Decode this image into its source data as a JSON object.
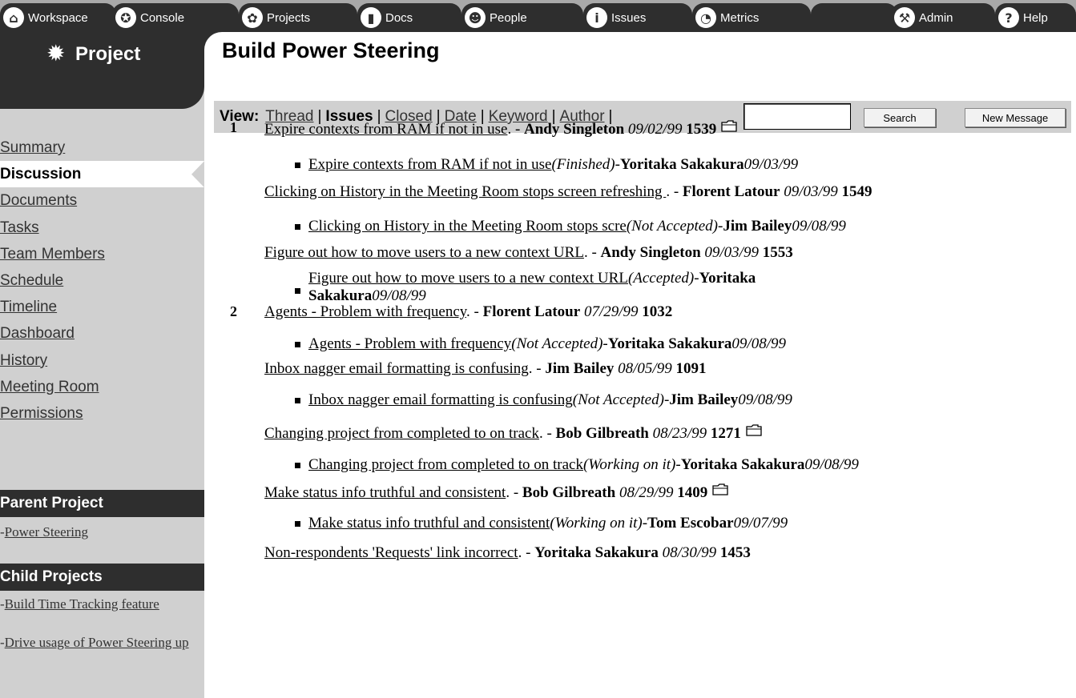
{
  "tabs": [
    {
      "label": "Workspace",
      "icon": "home-icon"
    },
    {
      "label": "Console",
      "icon": "console-icon"
    },
    {
      "label": "Projects",
      "icon": "projects-icon"
    },
    {
      "label": "Docs",
      "icon": "docs-icon"
    },
    {
      "label": "People",
      "icon": "people-icon"
    },
    {
      "label": "Issues",
      "icon": "info-icon"
    },
    {
      "label": "Metrics",
      "icon": "metrics-icon"
    },
    {
      "label": "",
      "icon": ""
    },
    {
      "label": "Admin",
      "icon": "admin-icon"
    },
    {
      "label": "Help",
      "icon": "help-icon"
    }
  ],
  "sidebar": {
    "title": "Project",
    "items": [
      {
        "label": "Summary"
      },
      {
        "label": "Discussion",
        "active": true
      },
      {
        "label": "Documents"
      },
      {
        "label": "Tasks"
      },
      {
        "label": "Team Members"
      },
      {
        "label": "Schedule"
      },
      {
        "label": "Timeline"
      },
      {
        "label": "Dashboard"
      },
      {
        "label": "History"
      },
      {
        "label": "Meeting Room"
      },
      {
        "label": "Permissions"
      }
    ],
    "parent_heading": "Parent Project",
    "parent_link": "Power Steering",
    "child_heading": "Child Projects",
    "child_links": [
      "Build Time Tracking feature",
      "Drive usage of Power Steering up"
    ]
  },
  "main": {
    "title": "Build Power Steering",
    "view_label": "View:",
    "views": [
      "Thread",
      "Issues",
      "Closed",
      "Date",
      "Keyword",
      "Author"
    ],
    "current_view": "Issues",
    "search_value": "",
    "search_button": "Search",
    "new_message_button": "New Message"
  },
  "threads": [
    {
      "group": "1",
      "title": "Expire contexts from RAM if not in use",
      "author": "Andy Singleton",
      "date": "09/02/99",
      "id": "1539",
      "attachment": true,
      "reply": {
        "title": "Expire contexts from RAM if not in use",
        "status": "(Finished)",
        "author": "Yoritaka Sakakura",
        "date": "09/03/99"
      }
    },
    {
      "group": "",
      "title": "Clicking on History in the Meeting Room stops screen refreshing ",
      "author": "Florent Latour",
      "date": "09/03/99",
      "id": "1549",
      "attachment": false,
      "reply": {
        "title": "Clicking on History in the Meeting Room stops scre",
        "status": "(Not Accepted)",
        "author": "Jim Bailey",
        "date": "09/08/99"
      }
    },
    {
      "group": "",
      "title": "Figure out how to move users to a new context URL",
      "author": "Andy Singleton",
      "date": "09/03/99",
      "id": "1553",
      "attachment": false,
      "reply": {
        "title": "Figure out how to move users to a new context URL",
        "status": "(Accepted)",
        "author": "Yoritaka Sakakura",
        "date": "09/08/99"
      }
    },
    {
      "group": "2",
      "title": "Agents - Problem with frequency",
      "author": "Florent Latour",
      "date": "07/29/99",
      "id": "1032",
      "attachment": false,
      "reply": {
        "title": "Agents - Problem with frequency",
        "status": "(Not Accepted)",
        "author": "Yoritaka Sakakura",
        "date": "09/08/99"
      }
    },
    {
      "group": "",
      "title": "Inbox nagger email formatting is confusing",
      "author": "Jim Bailey",
      "date": "08/05/99",
      "id": "1091",
      "attachment": false,
      "reply": {
        "title": "Inbox nagger email formatting is confusing",
        "status": "(Not Accepted)",
        "author": "Jim Bailey",
        "date": "09/08/99"
      }
    },
    {
      "group": "",
      "title": "Changing project from completed to on track",
      "author": "Bob Gilbreath",
      "date": "08/23/99",
      "id": "1271",
      "attachment": true,
      "reply": {
        "title": "Changing project from completed to on track",
        "status": "(Working on it)",
        "author": "Yoritaka Sakakura",
        "date": "09/08/99"
      }
    },
    {
      "group": "",
      "title": "Make status info truthful and consistent",
      "author": "Bob Gilbreath",
      "date": "08/29/99",
      "id": "1409",
      "attachment": true,
      "reply": {
        "title": "Make status info truthful and consistent",
        "status": "(Working on it)",
        "author": "Tom Escobar",
        "date": "09/07/99"
      }
    },
    {
      "group": "",
      "title": "Non-respondents 'Requests' link incorrect",
      "author": "Yoritaka Sakakura",
      "date": "08/30/99",
      "id": "1453",
      "attachment": false
    }
  ]
}
